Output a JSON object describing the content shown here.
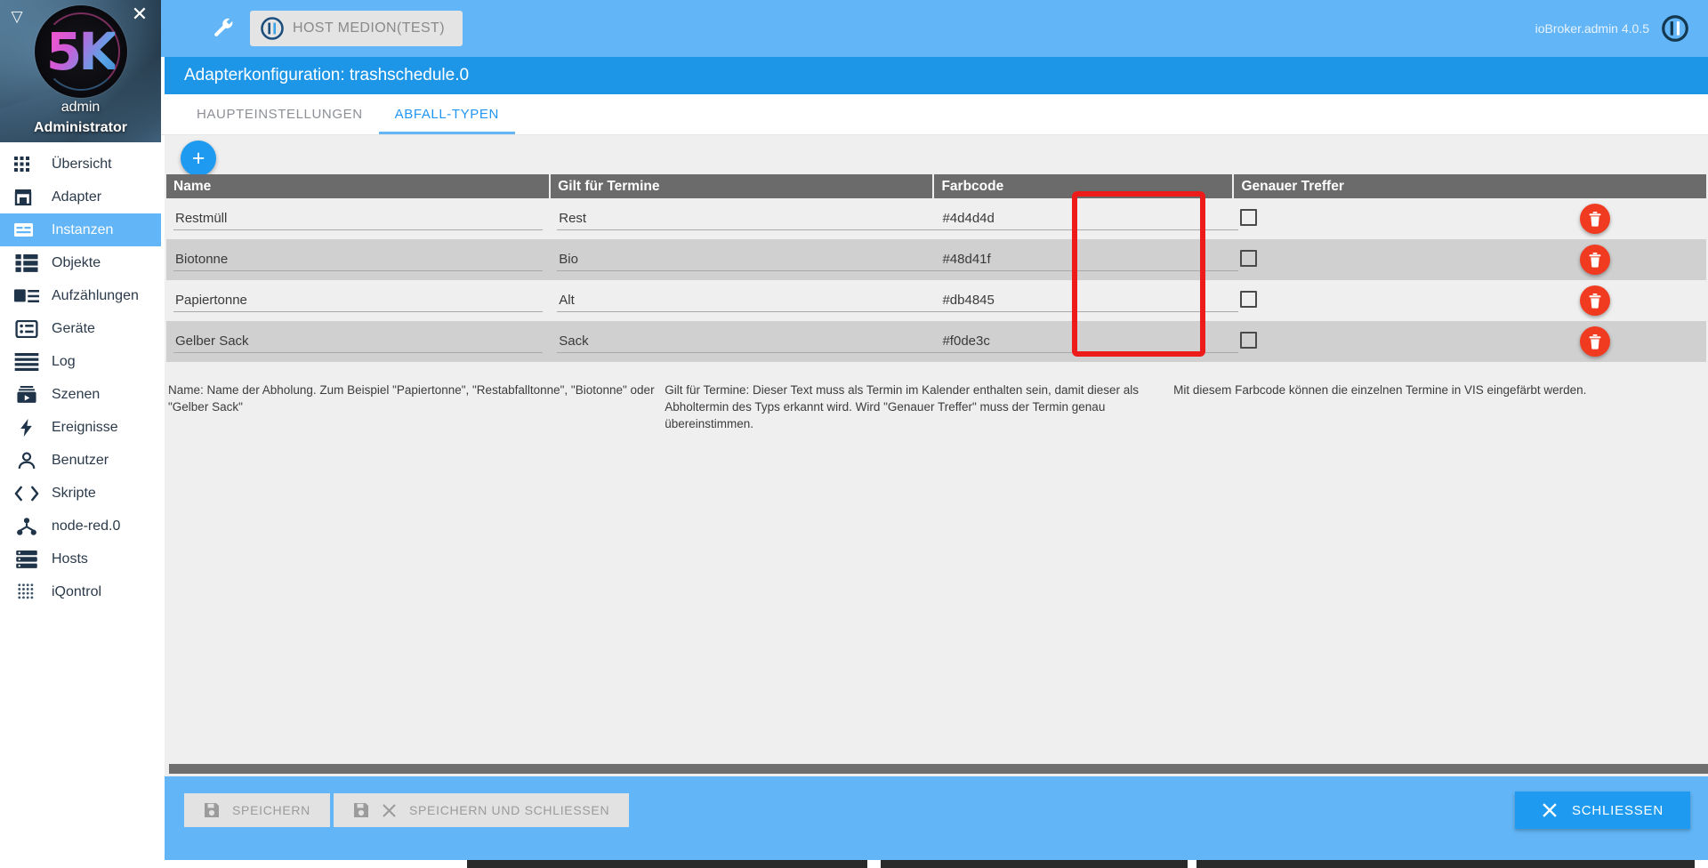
{
  "sidebar": {
    "user": {
      "name": "admin",
      "role": "Administrator"
    },
    "close_icon": "close-icon",
    "collapse_icon": "collapse-triangle-icon",
    "items": [
      {
        "label": "Übersicht",
        "icon": "grid-icon",
        "active": false
      },
      {
        "label": "Adapter",
        "icon": "store-icon",
        "active": false
      },
      {
        "label": "Instanzen",
        "icon": "instances-icon",
        "active": true
      },
      {
        "label": "Objekte",
        "icon": "objects-icon",
        "active": false
      },
      {
        "label": "Aufzählungen",
        "icon": "enum-icon",
        "active": false
      },
      {
        "label": "Geräte",
        "icon": "devices-icon",
        "active": false
      },
      {
        "label": "Log",
        "icon": "log-lines-icon",
        "active": false
      },
      {
        "label": "Szenen",
        "icon": "scenes-icon",
        "active": false
      },
      {
        "label": "Ereignisse",
        "icon": "bolt-icon",
        "active": false
      },
      {
        "label": "Benutzer",
        "icon": "user-icon",
        "active": false
      },
      {
        "label": "Skripte",
        "icon": "code-icon",
        "active": false
      },
      {
        "label": "node-red.0",
        "icon": "node-red-icon",
        "active": false
      },
      {
        "label": "Hosts",
        "icon": "server-icon",
        "active": false
      },
      {
        "label": "iQontrol",
        "icon": "dots-grid-icon",
        "active": false
      }
    ]
  },
  "topbar": {
    "wrench_icon": "wrench-icon",
    "host_label": "HOST MEDION(TEST)",
    "host_icon": "iobroker-logo-icon",
    "version": "ioBroker.admin 4.0.5",
    "power_icon": "power-icon"
  },
  "config": {
    "title": "Adapterkonfiguration: trashschedule.0",
    "tabs": [
      {
        "label": "HAUPTEINSTELLUNGEN",
        "active": false
      },
      {
        "label": "ABFALL-TYPEN",
        "active": true
      }
    ]
  },
  "toolbar": {
    "add_label": "+"
  },
  "table": {
    "columns": [
      "Name",
      "Gilt für Termine",
      "Farbcode",
      "Genauer Treffer"
    ],
    "rows": [
      {
        "name": "Restmüll",
        "term": "Rest",
        "color": "#4d4d4d",
        "exact": false,
        "delete_icon": "trash-icon"
      },
      {
        "name": "Biotonne",
        "term": "Bio",
        "color": "#48d41f",
        "exact": false,
        "delete_icon": "trash-icon"
      },
      {
        "name": "Papiertonne",
        "term": "Alt",
        "color": "#db4845",
        "exact": false,
        "delete_icon": "trash-icon"
      },
      {
        "name": "Gelber Sack",
        "term": "Sack",
        "color": "#f0de3c",
        "exact": false,
        "delete_icon": "trash-icon"
      }
    ]
  },
  "hints": {
    "name": "Name: Name der Abholung. Zum Beispiel \"Papiertonne\", \"Restabfalltonne\", \"Biotonne\" oder \"Gelber Sack\"",
    "term": "Gilt für Termine: Dieser Text muss als Termin im Kalender enthalten sein, damit dieser als Abholtermin des Typs erkannt wird. Wird \"Genauer Treffer\" muss der Termin genau übereinstimmen.",
    "color": "Mit diesem Farbcode können die einzelnen Termine in VIS eingefärbt werden."
  },
  "footer": {
    "save_label": "SPEICHERN",
    "save_icon": "floppy-icon",
    "save_close_label": "SPEICHERN UND SCHLIESSEN",
    "save_close_icon": "floppy-icon",
    "save_close_x_icon": "close-icon",
    "close_label": "SCHLIESSEN",
    "close_icon": "close-icon"
  },
  "annotation": {
    "color": "#ee1b1b",
    "target": "farbcode-column-highlight"
  }
}
